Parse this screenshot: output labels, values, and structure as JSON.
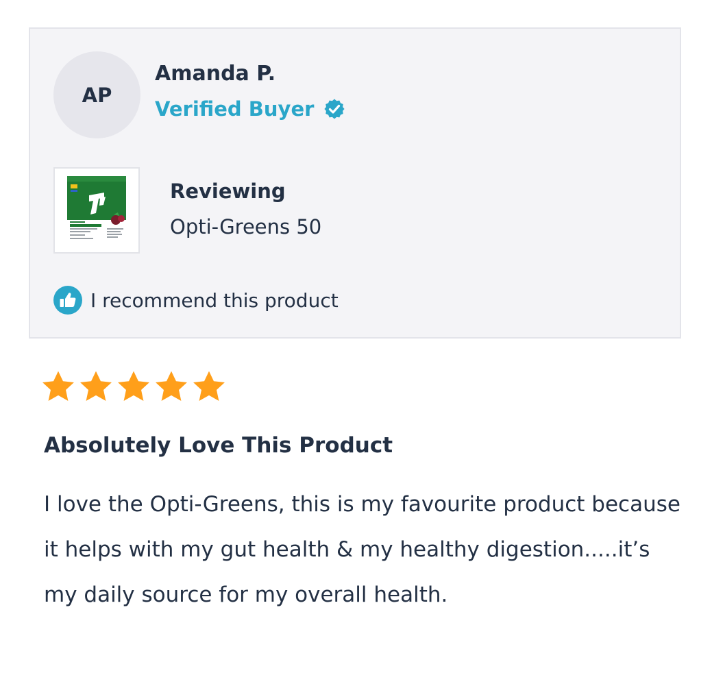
{
  "reviewer": {
    "initials": "AP",
    "name": "Amanda P.",
    "verified_label": "Verified Buyer",
    "verified_icon": "check-badge-icon"
  },
  "product": {
    "reviewing_label": "Reviewing",
    "name": "Opti-Greens 50",
    "thumbnail_icon": "product-pouch-icon"
  },
  "recommend": {
    "icon": "thumbs-up-icon",
    "text": "I recommend this product"
  },
  "rating": {
    "value": 5,
    "max": 5
  },
  "review": {
    "title": "Absolutely Love This Product",
    "body": "I love the Opti-Greens, this is my favourite product because it helps with my gut health & my healthy digestion.....it’s my daily source for my overall health."
  },
  "colors": {
    "accent": "#2aa6c9",
    "star": "#ff9f1a",
    "text": "#233044",
    "card_bg": "#f4f4f7"
  }
}
